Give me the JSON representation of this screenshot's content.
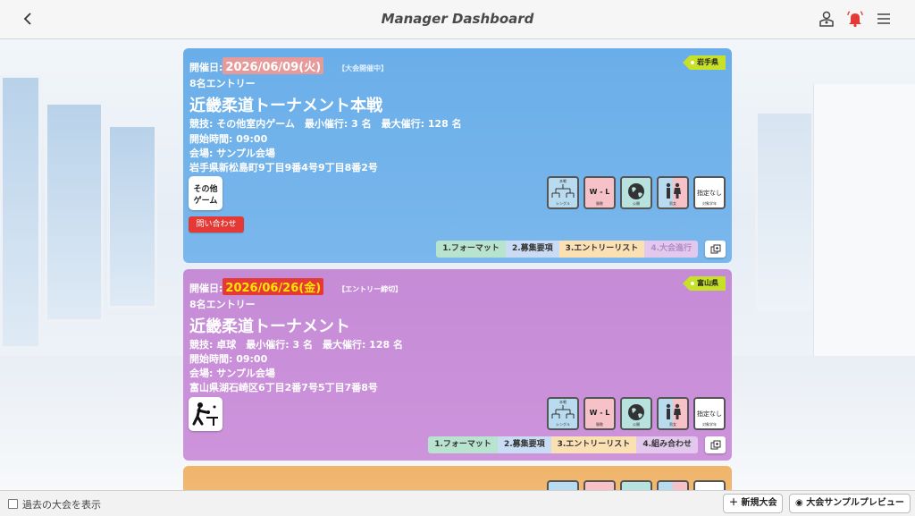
{
  "header": {
    "title": "Manager Dashboard",
    "back_icon": "chevron-left-icon",
    "right_icons": [
      "user-badge-icon",
      "bell-icon",
      "menu-icon"
    ],
    "bell_color": "#e53935"
  },
  "tournaments": [
    {
      "date_label": "開催日:",
      "date": "2026/06/09(火)",
      "status": "【大会開催中】",
      "prefecture": "岩手県",
      "entries": "8名エントリー",
      "name": "近畿柔道トーナメント本戦",
      "details": "競技: その他室内ゲーム　最小催行: 3 名　最大催行: 128 名",
      "start_time": "開始時間: 09:00",
      "venue": "会場: サンプル会場",
      "address": "岩手県新松島町9丁目9番4号9丁目8番2号",
      "game_icon_text": [
        "その他",
        "ゲーム"
      ],
      "inquiry_label": "問い合わせ",
      "badges": [
        {
          "icon": "tournament-bracket-icon",
          "top": "本戦",
          "caption": "シングル"
        },
        {
          "icon": "win-loss-icon",
          "text": "W - L",
          "caption": "勝敗"
        },
        {
          "icon": "globe-icon",
          "caption": "公開"
        },
        {
          "icon": "gender-icon",
          "caption": "男女"
        },
        {
          "icon": "none-icon",
          "text": "指定なし",
          "caption": "対象学年"
        }
      ],
      "steps": [
        "1.フォーマット",
        "2.募集要項",
        "3.エントリーリスト",
        "4.大会進行"
      ],
      "accent": "#6aaee9"
    },
    {
      "date_label": "開催日:",
      "date": "2026/06/26(金)",
      "status": "【エントリー締切】",
      "prefecture": "富山県",
      "entries": "8名エントリー",
      "name": "近畿柔道トーナメント",
      "details": "競技: 卓球　最小催行: 3 名　最大催行: 128 名",
      "start_time": "開始時間: 09:00",
      "venue": "会場: サンプル会場",
      "address": "富山県湖石崎区6丁目2番7号5丁目7番8号",
      "game_icon": "table-tennis-icon",
      "badges": [
        {
          "icon": "tournament-bracket-icon",
          "top": "本戦",
          "caption": "シングル"
        },
        {
          "icon": "win-loss-icon",
          "text": "W - L",
          "caption": "勝敗"
        },
        {
          "icon": "globe-icon",
          "caption": "公開"
        },
        {
          "icon": "gender-icon",
          "caption": "男女"
        },
        {
          "icon": "none-icon",
          "text": "指定なし",
          "caption": "対象学年"
        }
      ],
      "steps": [
        "1.フォーマット",
        "2.募集要項",
        "3.エントリーリスト",
        "4.組み合わせ"
      ],
      "accent": "#c58bd6"
    }
  ],
  "footer": {
    "show_past_label": "過去の大会を表示",
    "new_button": "新規大会",
    "preview_button": "大会サンプルプレビュー"
  }
}
